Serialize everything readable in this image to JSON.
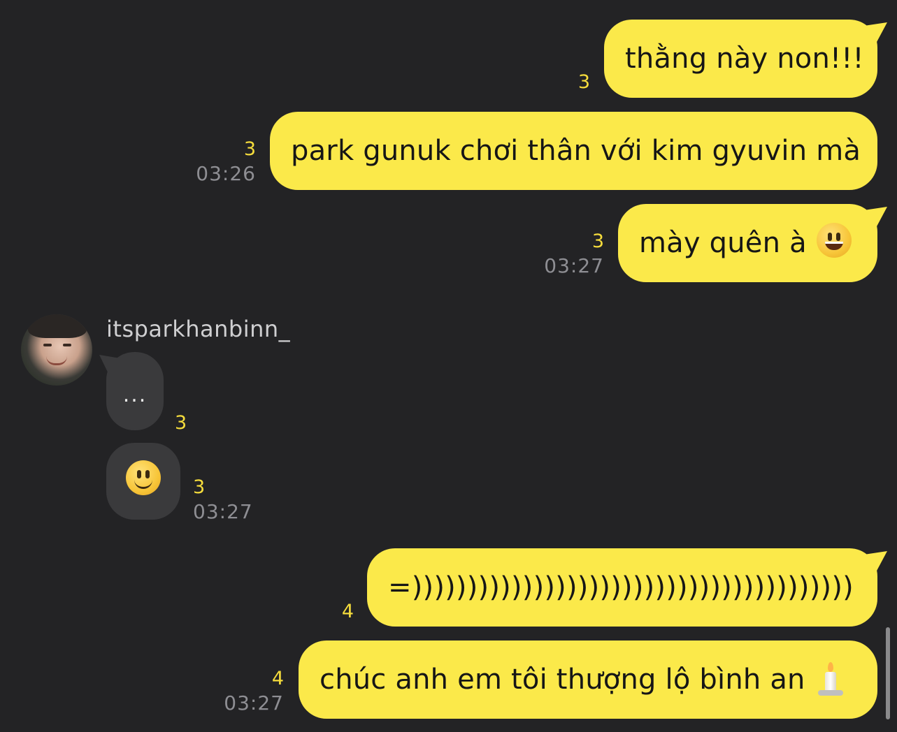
{
  "messages": [
    {
      "text": "thằng này non!!!",
      "unread": "3",
      "time": ""
    },
    {
      "text": "park gunuk chơi thân với kim gyuvin mà",
      "unread": "3",
      "time": "03:26"
    },
    {
      "text": "mày quên à",
      "emoji": "grinning-face",
      "unread": "3",
      "time": "03:27"
    },
    {
      "text": "=))))))))))))))))))))))))))))))))))))))))",
      "unread": "4",
      "time": ""
    },
    {
      "text": "chúc anh em tôi thượng lộ bình an",
      "emoji": "candle",
      "unread": "4",
      "time": "03:27"
    }
  ],
  "incoming": {
    "username": "itsparkhanbinn_",
    "messages": [
      {
        "text": "...",
        "unread": "3",
        "time": ""
      },
      {
        "emoji": "slightly-smiling-face",
        "unread": "3",
        "time": "03:27"
      }
    ]
  },
  "colors": {
    "background": "#232325",
    "outgoing_bubble": "#fbe94a",
    "incoming_bubble": "#3a3a3c",
    "unread": "#f5dc3c",
    "time": "#8e8e93"
  }
}
